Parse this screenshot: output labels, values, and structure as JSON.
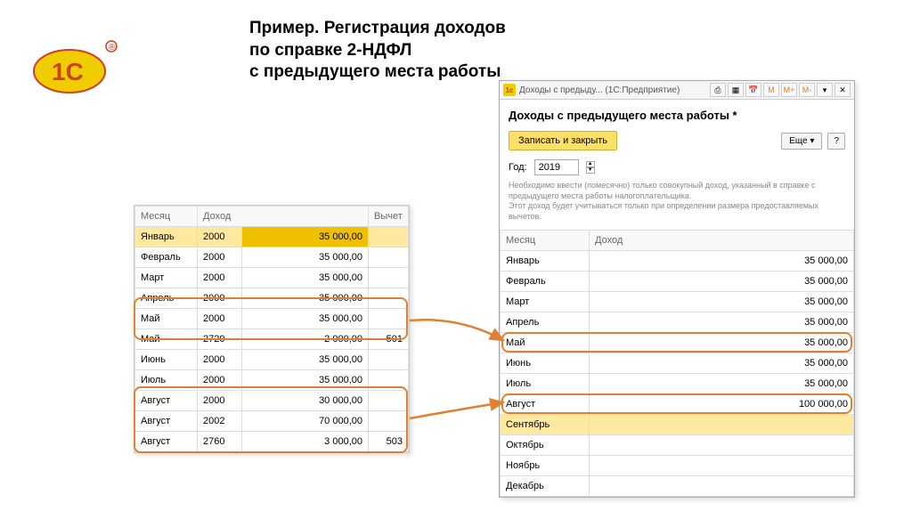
{
  "logo_alt": "1С",
  "title_line1": "Пример. Регистрация доходов",
  "title_line2": "по справке 2-НДФЛ",
  "title_line3": "с предыдущего места работы",
  "left": {
    "headers": {
      "month": "Месяц",
      "income": "Доход",
      "deduction": "Вычет"
    },
    "rows": [
      {
        "month": "Январь",
        "code": "2000",
        "amount": "35 000,00",
        "ded": ""
      },
      {
        "month": "Февраль",
        "code": "2000",
        "amount": "35 000,00",
        "ded": ""
      },
      {
        "month": "Март",
        "code": "2000",
        "amount": "35 000,00",
        "ded": ""
      },
      {
        "month": "Апрель",
        "code": "2000",
        "amount": "35 000,00",
        "ded": ""
      },
      {
        "month": "Май",
        "code": "2000",
        "amount": "35 000,00",
        "ded": ""
      },
      {
        "month": "Май",
        "code": "2720",
        "amount": "2 000,00",
        "ded": "501"
      },
      {
        "month": "Июнь",
        "code": "2000",
        "amount": "35 000,00",
        "ded": ""
      },
      {
        "month": "Июль",
        "code": "2000",
        "amount": "35 000,00",
        "ded": ""
      },
      {
        "month": "Август",
        "code": "2000",
        "amount": "30 000,00",
        "ded": ""
      },
      {
        "month": "Август",
        "code": "2002",
        "amount": "70 000,00",
        "ded": ""
      },
      {
        "month": "Август",
        "code": "2760",
        "amount": "3 000,00",
        "ded": "503"
      }
    ]
  },
  "right": {
    "window_title": "Доходы с предыду... (1С:Предприятие)",
    "form_title": "Доходы с предыдущего места работы *",
    "btn_save": "Записать и закрыть",
    "btn_more": "Еще",
    "btn_help": "?",
    "year_label": "Год:",
    "year_value": "2019",
    "help_text1": "Необходимо ввести (помесячно) только совокупный доход, указанный в справке с предыдущего места работы налогоплательщика.",
    "help_text2": "Этот доход будет учитываться только при определении размера предоставляемых вычетов.",
    "headers": {
      "month": "Месяц",
      "income": "Доход"
    },
    "rows": [
      {
        "month": "Январь",
        "amount": "35 000,00"
      },
      {
        "month": "Февраль",
        "amount": "35 000,00"
      },
      {
        "month": "Март",
        "amount": "35 000,00"
      },
      {
        "month": "Апрель",
        "amount": "35 000,00"
      },
      {
        "month": "Май",
        "amount": "35 000,00"
      },
      {
        "month": "Июнь",
        "amount": "35 000,00"
      },
      {
        "month": "Июль",
        "amount": "35 000,00"
      },
      {
        "month": "Август",
        "amount": "100 000,00"
      },
      {
        "month": "Сентябрь",
        "amount": ""
      },
      {
        "month": "Октябрь",
        "amount": ""
      },
      {
        "month": "Ноябрь",
        "amount": ""
      },
      {
        "month": "Декабрь",
        "amount": ""
      }
    ],
    "tool_labels": {
      "m": "M",
      "mplus": "M+",
      "mminus": "M-"
    }
  }
}
